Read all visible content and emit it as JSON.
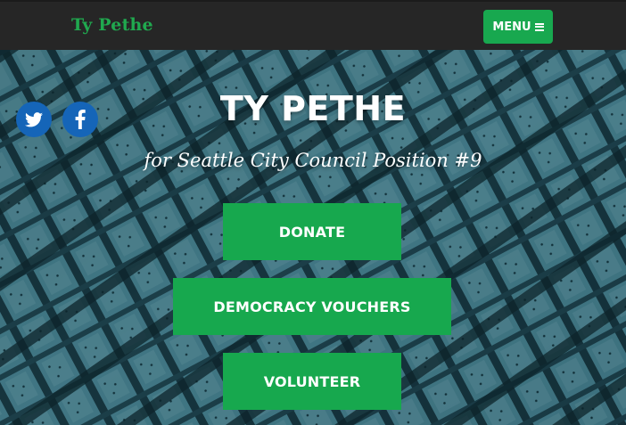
{
  "header": {
    "brand": "Ty Pethe",
    "menu_label": "MENU"
  },
  "hero": {
    "title": "TY PETHE",
    "subtitle": "for Seattle City Council Position #9",
    "buttons": {
      "donate": "DONATE",
      "vouchers": "DEMOCRACY VOUCHERS",
      "volunteer": "VOLUNTEER"
    }
  },
  "social": {
    "twitter_icon": "twitter-icon",
    "facebook_icon": "facebook-icon"
  },
  "colors": {
    "brand_green": "#18a84f",
    "topbar": "#262626",
    "social_blue": "#1565b8"
  }
}
